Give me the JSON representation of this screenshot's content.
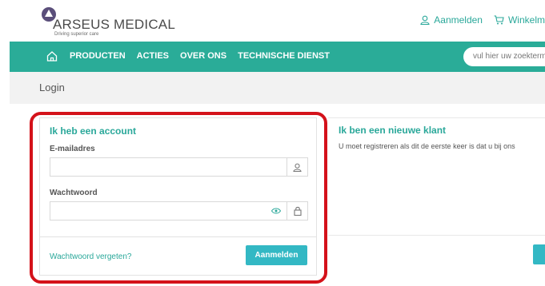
{
  "header": {
    "brand": "ARSEUS MEDICAL",
    "tagline": "Driving superior care",
    "login_link": "Aanmelden",
    "cart_link": "Winkelm",
    "icons": {
      "login": "user-icon",
      "cart": "cart-icon"
    }
  },
  "nav": {
    "home_icon": "home-icon",
    "items": [
      "PRODUCTEN",
      "ACTIES",
      "OVER ONS",
      "TECHNISCHE DIENST"
    ],
    "search_placeholder": "vul hier uw zoekterm"
  },
  "page": {
    "title": "Login"
  },
  "login": {
    "title": "Ik heb een account",
    "email_label": "E-mailadres",
    "email_value": "",
    "password_label": "Wachtwoord",
    "password_value": "",
    "forgot_link": "Wachtwoord vergeten?",
    "submit_label": "Aanmelden",
    "icons": {
      "email": "user-icon",
      "show_password": "eye-icon",
      "password": "lock-icon"
    }
  },
  "new_customer": {
    "title": "Ik ben een nieuwe klant",
    "text": "U moet registreren als dit de eerste keer is dat u bij ons"
  },
  "colors": {
    "accent": "#2aac98",
    "button": "#33b8c4",
    "annotation": "#d4121a",
    "brand_mark": "#5a4e7a"
  }
}
